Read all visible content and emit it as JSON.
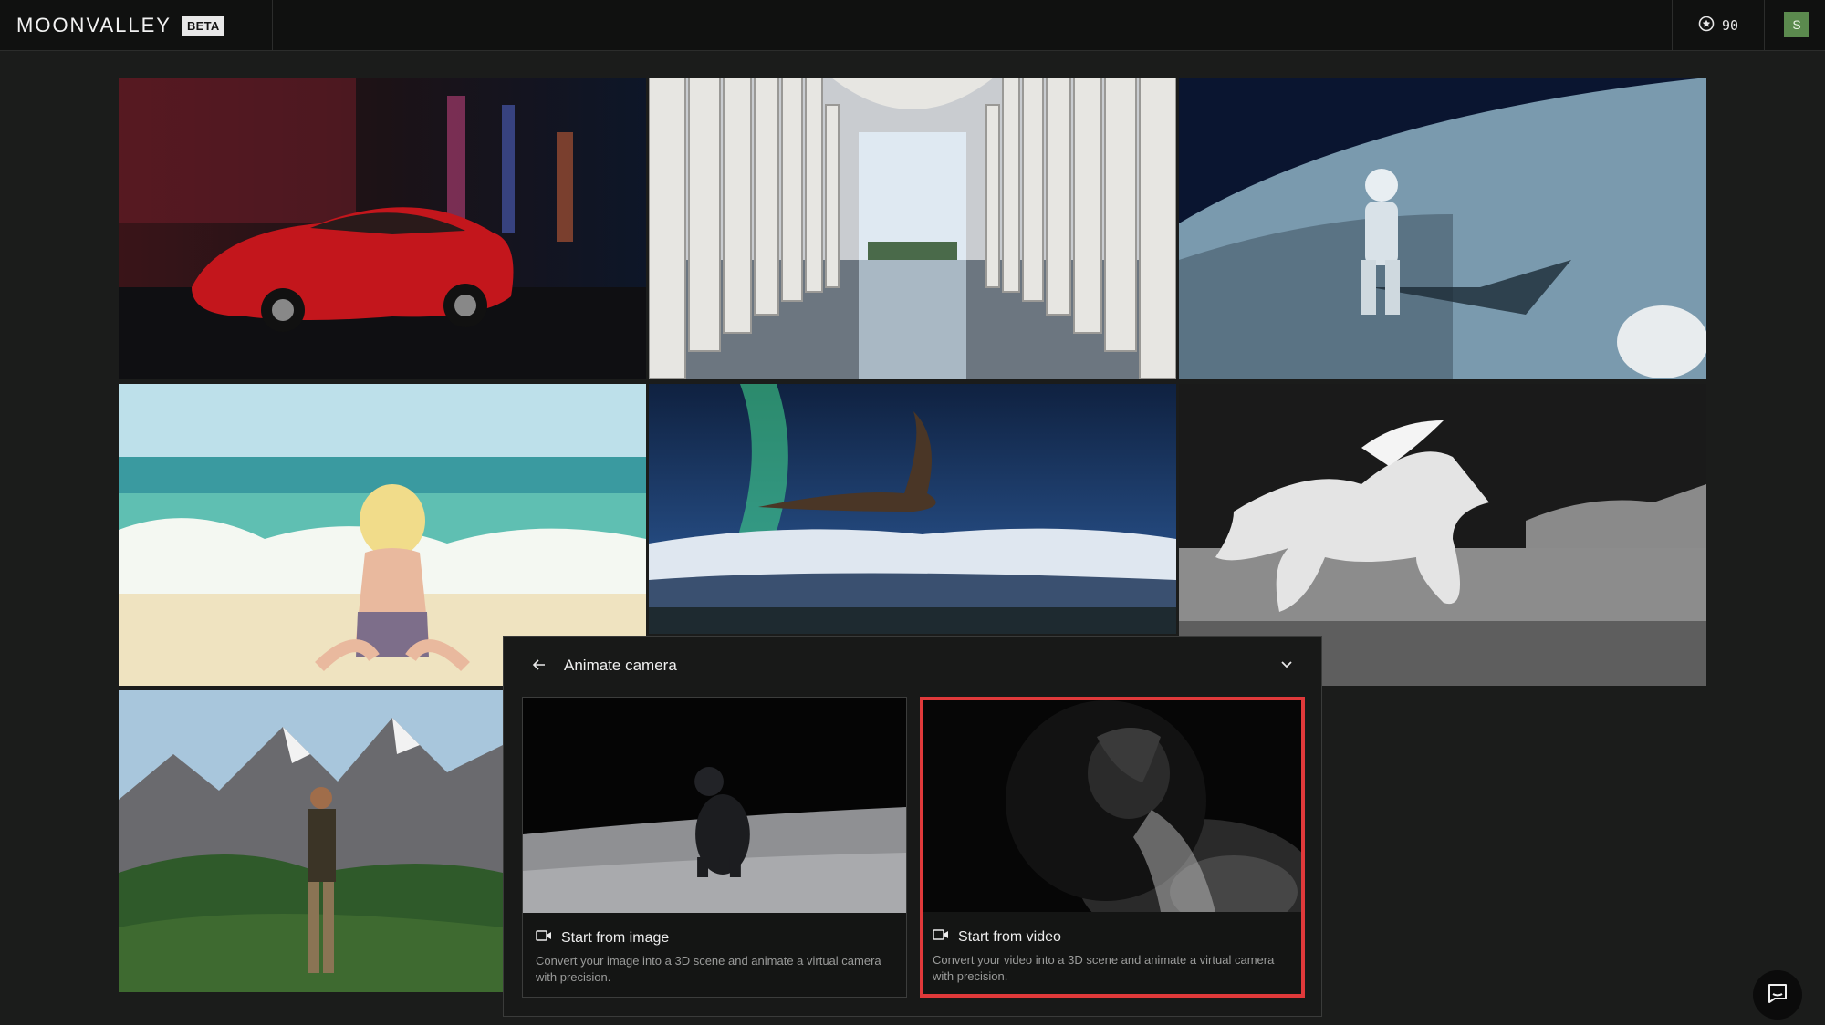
{
  "header": {
    "brand": "MOONVALLEY",
    "badge": "BETA",
    "credits": "90",
    "credits_icon": "star-coin-icon",
    "avatar_initial": "S"
  },
  "gallery": {
    "tiles": [
      {
        "name": "red-sports-car-night-city"
      },
      {
        "name": "marble-columns-reflecting-pool"
      },
      {
        "name": "astronaut-on-moon"
      },
      {
        "name": "anime-girl-beach"
      },
      {
        "name": "eagle-aurora"
      },
      {
        "name": "white-horse-moon"
      },
      {
        "name": "hiker-mountains"
      }
    ]
  },
  "panel": {
    "title": "Animate camera",
    "back_icon": "arrow-left-icon",
    "collapse_icon": "chevron-down-icon",
    "options": [
      {
        "label": "Start from image",
        "description": "Convert your image into a 3D scene and animate a virtual camera with precision.",
        "icon": "video-camera-icon",
        "selected": false
      },
      {
        "label": "Start from video",
        "description": "Convert your video into a 3D scene and animate a virtual camera with precision.",
        "icon": "video-camera-icon",
        "selected": true
      }
    ]
  },
  "colors": {
    "selection": "#e0393a",
    "avatar": "#5b8a4e",
    "background": "#1b1c1b"
  }
}
